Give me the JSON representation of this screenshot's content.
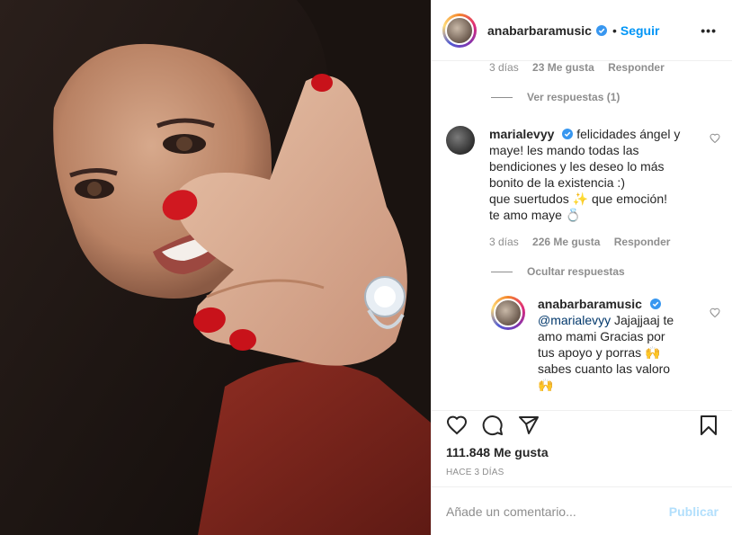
{
  "header": {
    "username": "anabarbaramusic",
    "separator": "•",
    "follow_label": "Seguir",
    "more_label": "•••"
  },
  "top_comment_meta": {
    "time": "3 días",
    "likes": "23 Me gusta",
    "reply": "Responder"
  },
  "view_replies": "Ver respuestas (1)",
  "comment2": {
    "username": "marialevyy",
    "text_line1": "felicidades ángel y",
    "text_line2": "maye! les mando todas las",
    "text_line3": "bendiciones y les deseo lo más",
    "text_line4": "bonito de la existencia :)",
    "text_line5": "que suertudos",
    "emoji1": "✨",
    "text_line5b": "que emoción!",
    "text_line6": "te amo maye",
    "emoji2": "💍",
    "time": "3 días",
    "likes": "226 Me gusta",
    "reply": "Responder"
  },
  "hide_replies": "Ocultar respuestas",
  "reply1": {
    "username": "anabarbaramusic",
    "mention": "@marialevyy",
    "text_line1": "Jajajjaaj te",
    "text_line2": "amo mami Gracias por",
    "text_line3": "tus apoyo y porras",
    "emoji1": "🙌",
    "text_line4": "sabes cuanto las valoro",
    "emoji2": "🙌"
  },
  "actions": {
    "likes_count": "111.848 Me gusta",
    "time_ago": "HACE 3 DÍAS"
  },
  "add_comment": {
    "placeholder": "Añade un comentario...",
    "publish_label": "Publicar"
  },
  "colors": {
    "link_blue": "#0095f6",
    "publish_disabled": "#b2dffc",
    "meta_gray": "#8e8e8e",
    "text": "#262626"
  }
}
